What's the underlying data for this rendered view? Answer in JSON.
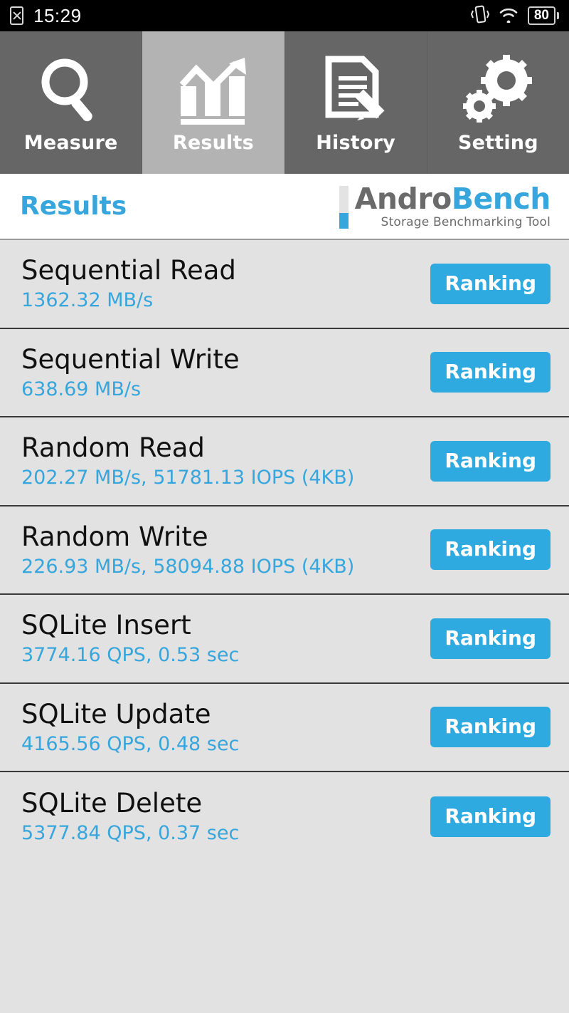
{
  "statusbar": {
    "sim_icon": "sim-card-missing-icon",
    "time": "15:29",
    "vibrate_icon": "vibrate-icon",
    "wifi_icon": "wifi-icon",
    "battery_level": "80"
  },
  "tabs": [
    {
      "label": "Measure",
      "icon": "magnifier-icon",
      "active": false
    },
    {
      "label": "Results",
      "icon": "bar-chart-trend-icon",
      "active": true
    },
    {
      "label": "History",
      "icon": "document-pencil-icon",
      "active": false
    },
    {
      "label": "Setting",
      "icon": "gears-icon",
      "active": false
    }
  ],
  "header": {
    "title": "Results",
    "logo_andro": "Andro",
    "logo_bench": "Bench",
    "logo_tagline": "Storage Benchmarking Tool"
  },
  "colors": {
    "accent_blue": "#36a6dd",
    "button_blue": "#2eaae0",
    "tab_inactive": "#666666",
    "tab_active": "#b3b3b3",
    "list_bg": "#e2e2e2"
  },
  "results": {
    "ranking_label": "Ranking",
    "rows": [
      {
        "title": "Sequential Read",
        "value": "1362.32 MB/s"
      },
      {
        "title": "Sequential Write",
        "value": "638.69 MB/s"
      },
      {
        "title": "Random Read",
        "value": "202.27 MB/s, 51781.13 IOPS (4KB)"
      },
      {
        "title": "Random Write",
        "value": "226.93 MB/s, 58094.88 IOPS (4KB)"
      },
      {
        "title": "SQLite Insert",
        "value": "3774.16 QPS, 0.53 sec"
      },
      {
        "title": "SQLite Update",
        "value": "4165.56 QPS, 0.48 sec"
      },
      {
        "title": "SQLite Delete",
        "value": "5377.84 QPS, 0.37 sec"
      }
    ]
  }
}
